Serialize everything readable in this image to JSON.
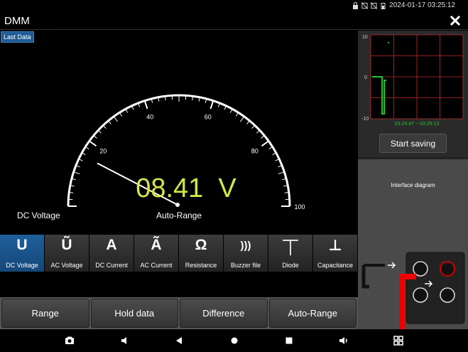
{
  "status": {
    "datetime": "2024-01-17 03:25:12"
  },
  "app": {
    "title": "DMM",
    "last_data_label": "Last Data"
  },
  "gauge": {
    "ticks": [
      "20",
      "40",
      "60",
      "80",
      "100"
    ],
    "scale_min": 0,
    "scale_max": 100,
    "needle_value": 8.41,
    "reading": "08.41  V",
    "mode_label": "DC Voltage",
    "range_label": "Auto-Range",
    "reading_color": "#d4e645"
  },
  "trend": {
    "y_ticks": [
      "10",
      "0",
      "-10"
    ],
    "timestamp": "03:24:47 ~ 03:25:13",
    "line_color": "#29c429",
    "grid_color": "#c62b2b"
  },
  "right_panel": {
    "save_button": "Start saving",
    "diagram_title": "Interface diagram"
  },
  "modes": [
    {
      "symbol": "U",
      "label": "DC Voltage",
      "active": true
    },
    {
      "symbol": "Ũ",
      "label": "AC Voltage",
      "active": false
    },
    {
      "symbol": "A",
      "label": "DC Current",
      "active": false
    },
    {
      "symbol": "Ã",
      "label": "AC Current",
      "active": false
    },
    {
      "symbol": "Ω",
      "label": "Resistance",
      "active": false
    },
    {
      "symbol": ")))",
      "label": "Buzzer file",
      "active": false
    },
    {
      "symbol": "⏉",
      "label": "Diode",
      "active": false
    },
    {
      "symbol": "⊥",
      "label": "Capacitance",
      "active": false
    }
  ],
  "actions": [
    "Range",
    "Hold data",
    "Difference",
    "Auto-Range"
  ],
  "navbar": [
    "camera-icon",
    "volume-down-icon",
    "back-icon",
    "home-icon",
    "recents-icon",
    "volume-up-icon",
    "apps-grid-icon"
  ]
}
